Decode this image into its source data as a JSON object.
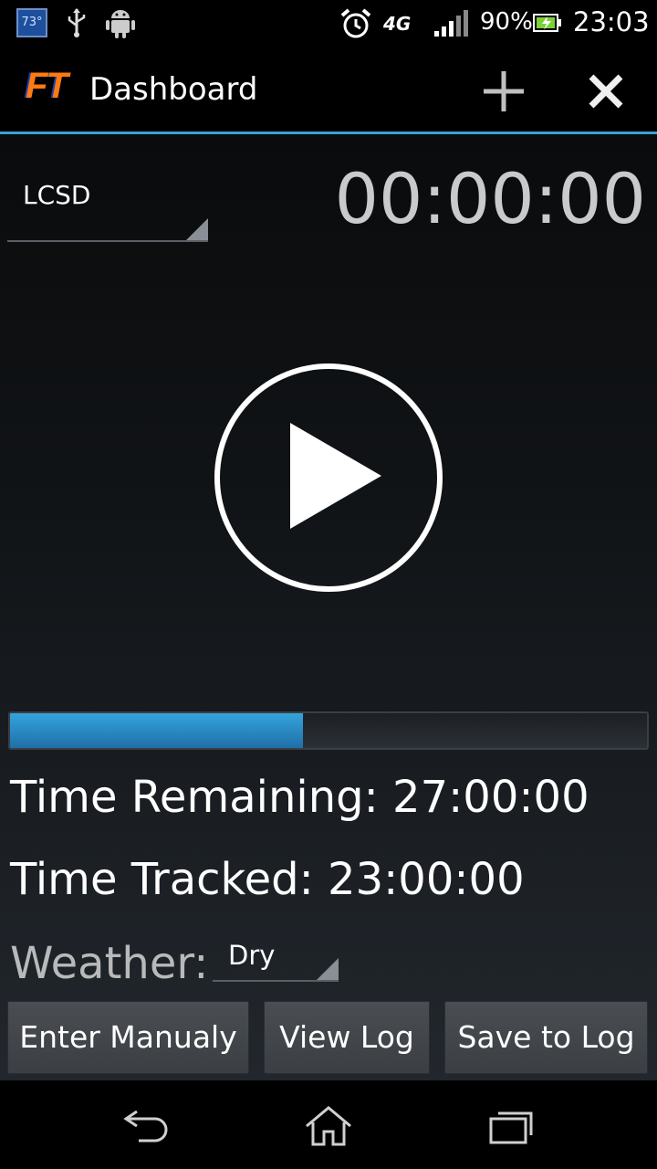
{
  "status_bar": {
    "temperature": "73°",
    "network_type": "4G",
    "battery_percent": "90%",
    "clock": "23:03",
    "icons": [
      "usb-icon",
      "android-icon",
      "alarm-icon",
      "signal-icon",
      "battery-icon"
    ]
  },
  "action_bar": {
    "logo": "FT",
    "title": "Dashboard",
    "icons": [
      "add-icon",
      "close-icon"
    ]
  },
  "dashboard": {
    "project_selected": "LCSD",
    "timer": "00:00:00",
    "play_icon": "play-icon",
    "progress_fraction": 0.46,
    "time_remaining": "Time Remaining: 27:00:00",
    "time_tracked": "Time Tracked: 23:00:00",
    "weather_label": "Weather:",
    "weather_selected": "Dry"
  },
  "buttons": {
    "enter_manually": "Enter Manualy",
    "view_log": "View Log",
    "save_to_log": "Save to Log"
  },
  "nav_bar": {
    "icons": [
      "back-icon",
      "home-icon",
      "recent-apps-icon"
    ]
  },
  "colors": {
    "accent": "#3aa0d8",
    "logo": "#ff7a10"
  }
}
